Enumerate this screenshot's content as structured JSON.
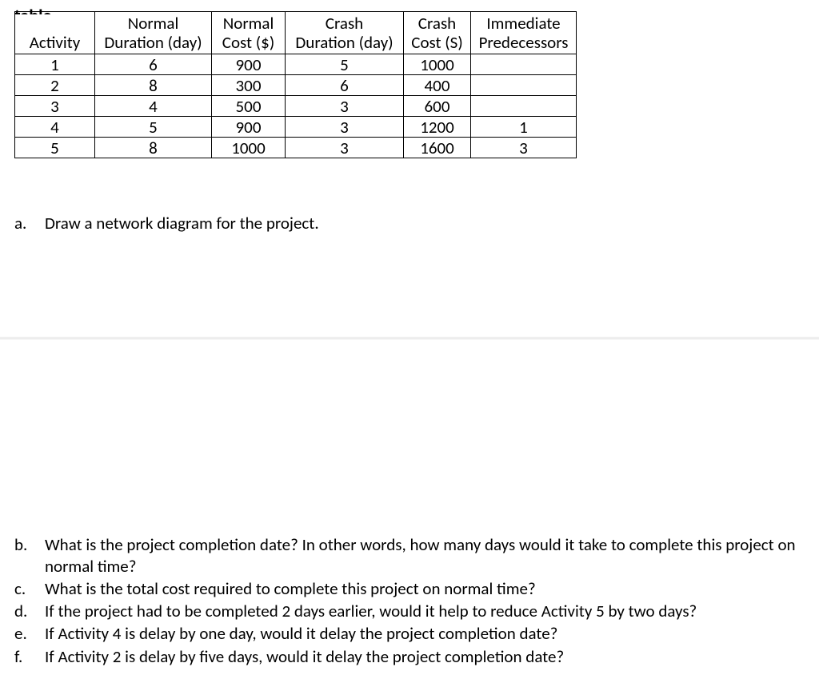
{
  "truncated": "table.",
  "table": {
    "headers": {
      "activity": "Activity",
      "normal_duration_l1": "Normal",
      "normal_duration_l2": "Duration (day)",
      "normal_cost_l1": "Normal",
      "normal_cost_l2": "Cost ($)",
      "crash_duration_l1": "Crash",
      "crash_duration_l2": "Duration (day)",
      "crash_cost_l1": "Crash",
      "crash_cost_l2": "Cost (S)",
      "predecessors_l1": "Immediate",
      "predecessors_l2": "Predecessors"
    },
    "rows": [
      {
        "activity": "1",
        "nd": "6",
        "nc": "900",
        "cd": "5",
        "cc": "1000",
        "pred": ""
      },
      {
        "activity": "2",
        "nd": "8",
        "nc": "300",
        "cd": "6",
        "cc": "400",
        "pred": ""
      },
      {
        "activity": "3",
        "nd": "4",
        "nc": "500",
        "cd": "3",
        "cc": "600",
        "pred": ""
      },
      {
        "activity": "4",
        "nd": "5",
        "nc": "900",
        "cd": "3",
        "cc": "1200",
        "pred": "1"
      },
      {
        "activity": "5",
        "nd": "8",
        "nc": "1000",
        "cd": "3",
        "cc": "1600",
        "pred": "3"
      }
    ]
  },
  "questions": {
    "a": {
      "marker": "a.",
      "text": "Draw a network diagram for the project."
    },
    "b": {
      "marker": "b.",
      "text": "What is the project completion date? In other words, how many days would it take to complete this project on normal time?"
    },
    "c": {
      "marker": "c.",
      "text": "What is the total cost required to complete this project on normal time?"
    },
    "d": {
      "marker": "d.",
      "text": "If the project had to be completed 2 days earlier, would it help to reduce Activity 5 by two days?"
    },
    "e": {
      "marker": "e.",
      "text": "If Activity 4 is delay by one day, would it delay the project completion date?"
    },
    "f": {
      "marker": "f.",
      "text": "If Activity 2 is delay by five days, would it delay the project completion date?"
    }
  }
}
